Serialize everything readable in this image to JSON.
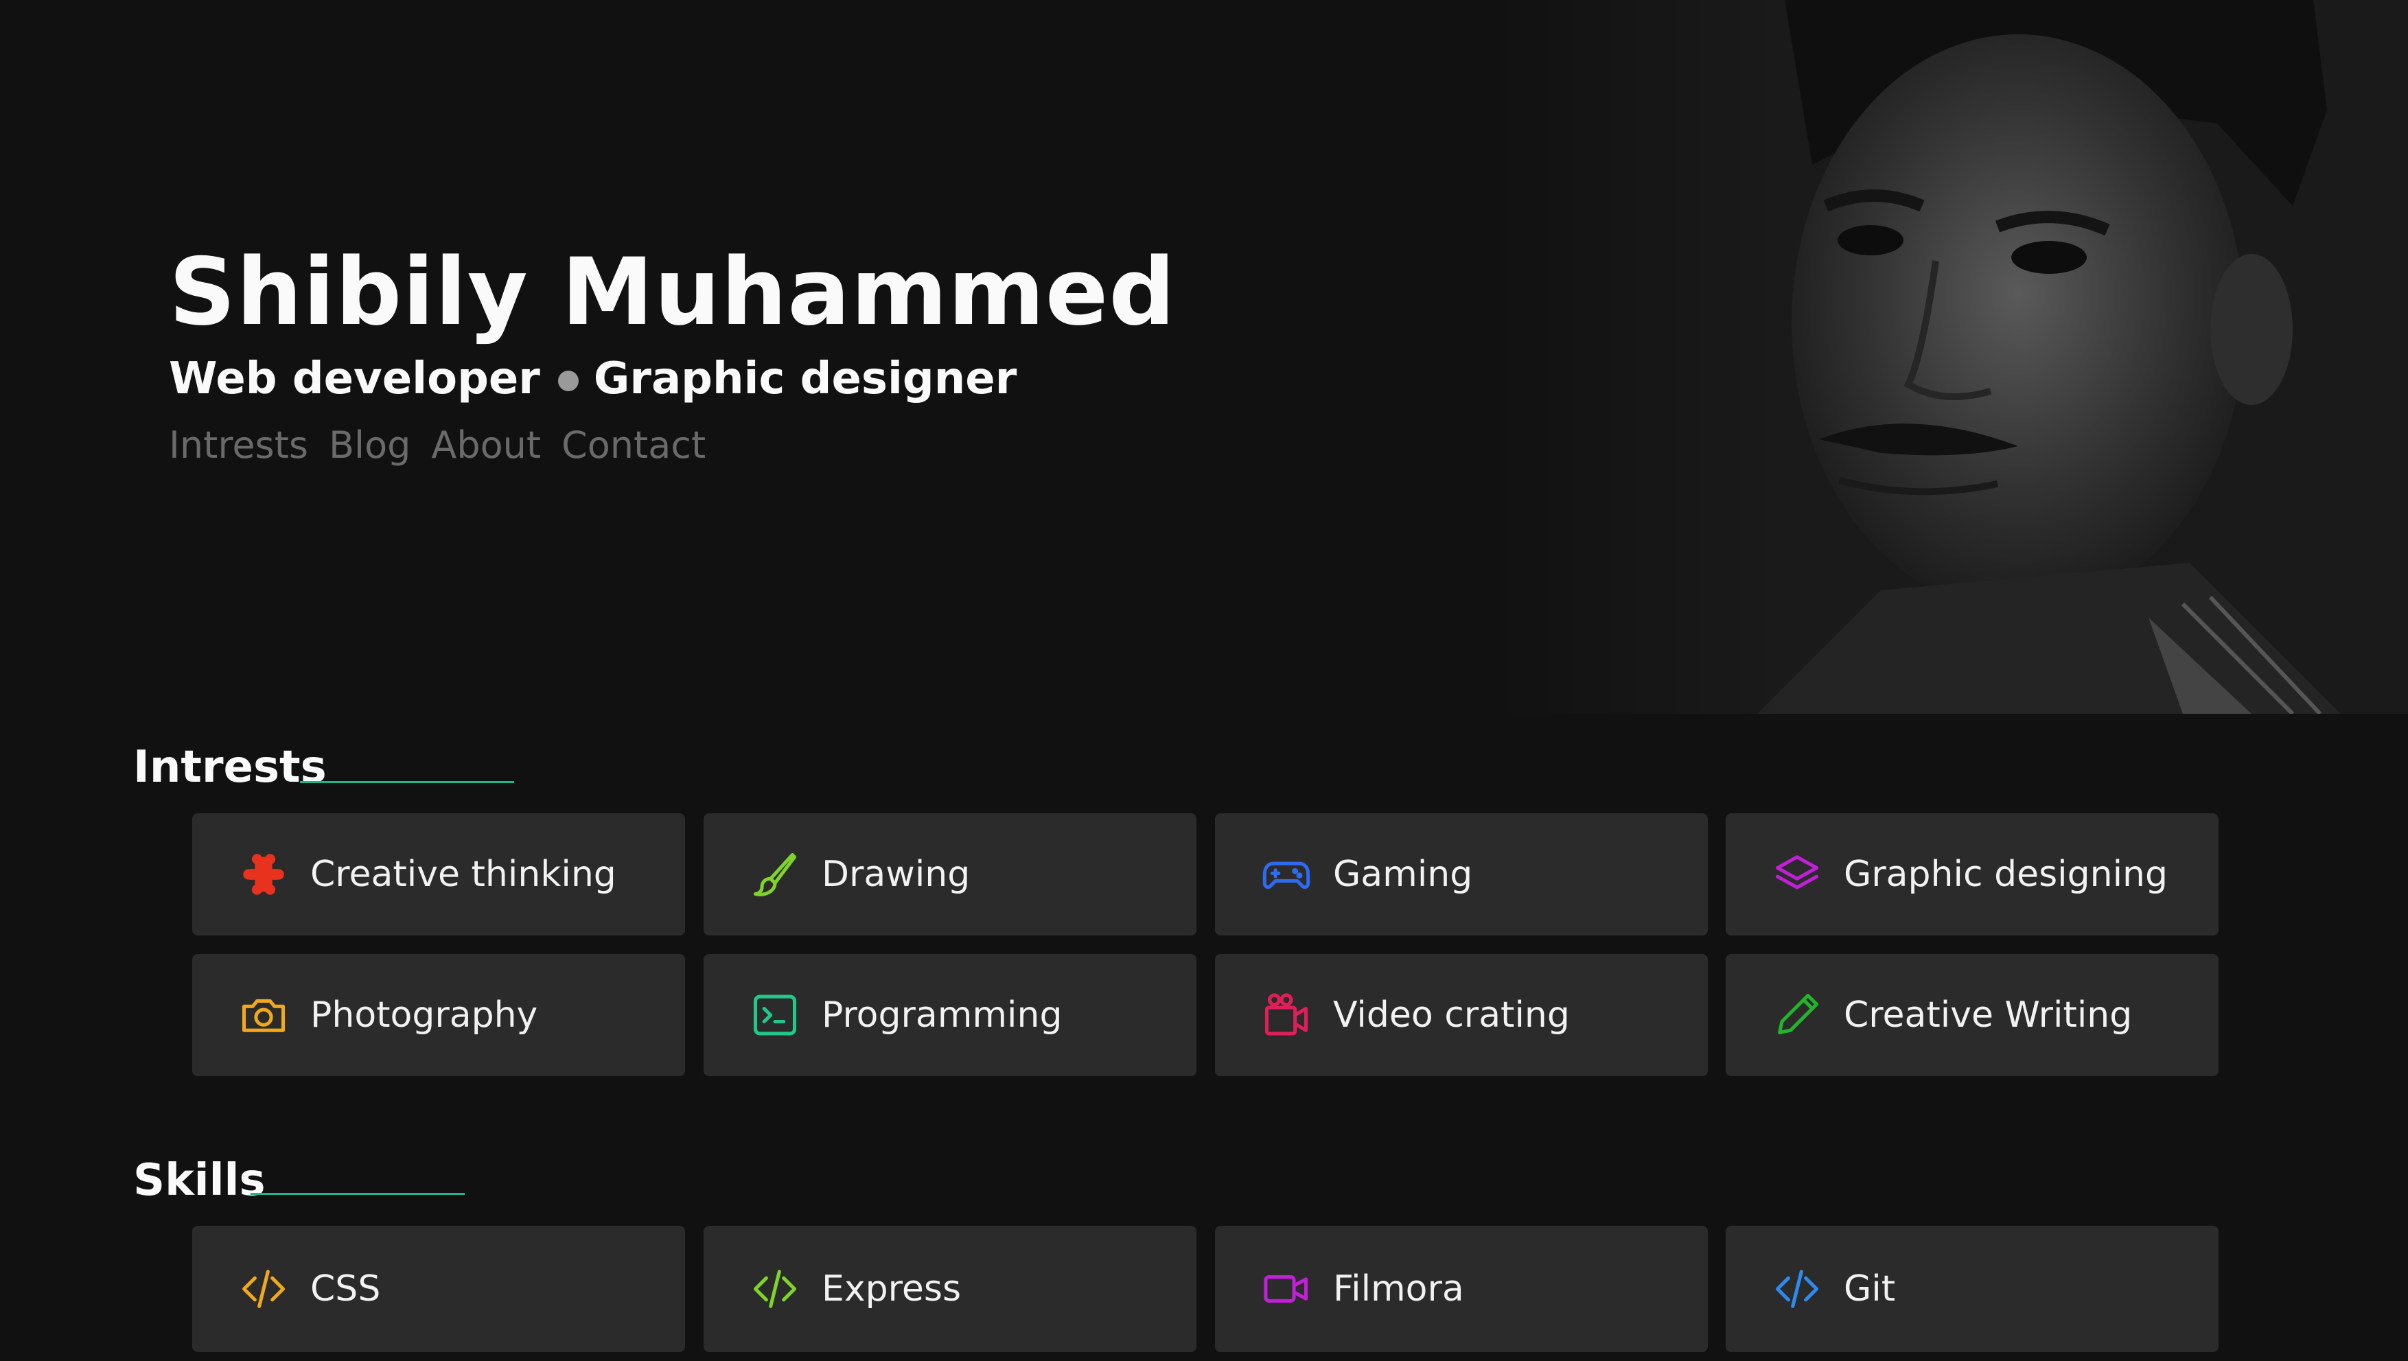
{
  "hero": {
    "name": "Shibily Muhammed",
    "role_primary": "Web developer",
    "role_secondary": "Graphic designer",
    "nav": [
      "Intrests",
      "Blog",
      "About",
      "Contact"
    ],
    "portrait_alt": "Portrait photo"
  },
  "interests": {
    "title": "Intrests",
    "items": [
      {
        "label": "Creative thinking",
        "icon": "creative-thinking-icon",
        "color": "#e8321e"
      },
      {
        "label": "Drawing",
        "icon": "brush-icon",
        "color": "#7fd42a"
      },
      {
        "label": "Gaming",
        "icon": "gamepad-icon",
        "color": "#2d6bf0"
      },
      {
        "label": "Graphic designing",
        "icon": "layers-icon",
        "color": "#c21fd8"
      },
      {
        "label": "Photography",
        "icon": "camera-icon",
        "color": "#f0a81c"
      },
      {
        "label": "Programming",
        "icon": "terminal-icon",
        "color": "#1fc98a"
      },
      {
        "label": "Video crating",
        "icon": "video-camera-icon",
        "color": "#e01f5a"
      },
      {
        "label": "Creative Writing",
        "icon": "pen-icon",
        "color": "#22b42a"
      }
    ]
  },
  "skills": {
    "title": "Skills",
    "items": [
      {
        "label": "CSS",
        "icon": "code-icon",
        "color": "#f0a81c"
      },
      {
        "label": "Express",
        "icon": "code-icon",
        "color": "#7fd42a"
      },
      {
        "label": "Filmora",
        "icon": "video-icon",
        "color": "#c21fd8"
      },
      {
        "label": "Git",
        "icon": "code-icon",
        "color": "#2d8bf0"
      }
    ]
  },
  "colors": {
    "background": "#111112",
    "card": "#2b2b2b",
    "accent_underline": "#1fb58a",
    "nav_text": "#6a6a6a"
  }
}
